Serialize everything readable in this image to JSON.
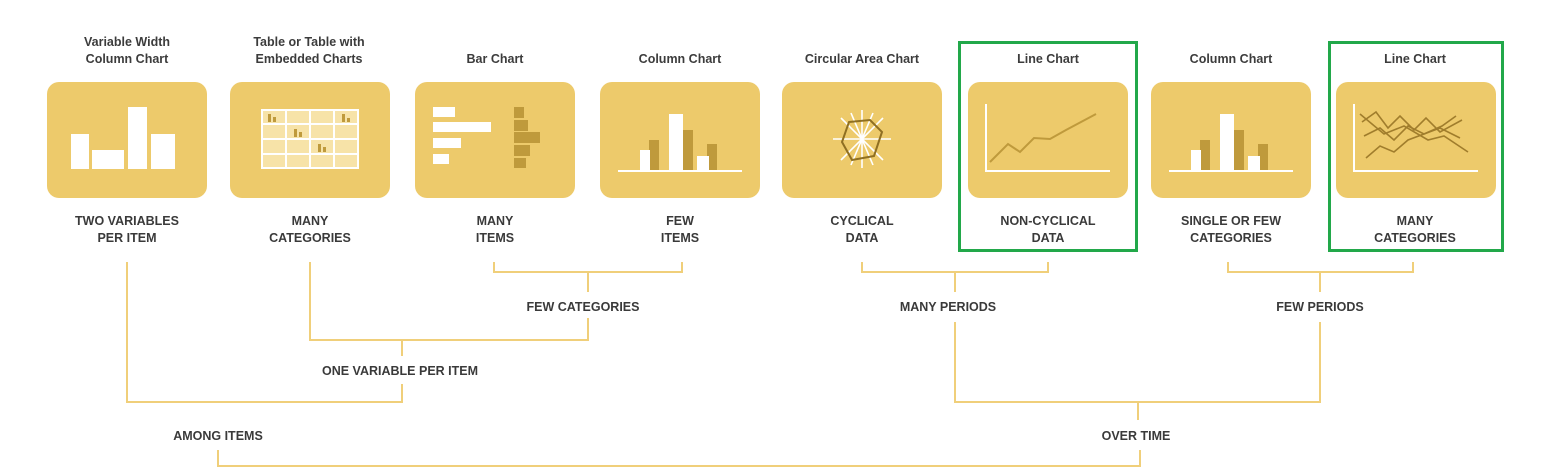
{
  "charts": [
    {
      "title": "Variable Width\nColumn Chart",
      "icon": "variable-width-column-chart-icon",
      "label": "TWO VARIABLES\nPER ITEM"
    },
    {
      "title": "Table or Table with\nEmbedded Charts",
      "icon": "table-with-embedded-charts-icon",
      "label": "MANY\nCATEGORIES"
    },
    {
      "title": "Bar Chart",
      "icon": "bar-chart-icon",
      "label": "MANY\nITEMS"
    },
    {
      "title": "Column Chart",
      "icon": "column-chart-icon",
      "label": "FEW\nITEMS"
    },
    {
      "title": "Circular Area Chart",
      "icon": "circular-area-chart-icon",
      "label": "CYCLICAL\nDATA"
    },
    {
      "title": "Line Chart",
      "icon": "line-chart-icon",
      "label": "NON-CYCLICAL\nDATA"
    },
    {
      "title": "Column Chart",
      "icon": "column-chart-icon",
      "label": "SINGLE OR FEW\nCATEGORIES"
    },
    {
      "title": "Line Chart",
      "icon": "multi-line-chart-icon",
      "label": "MANY\nCATEGORIES"
    }
  ],
  "groups": {
    "few_categories": "FEW CATEGORIES",
    "many_periods": "MANY PERIODS",
    "few_periods": "FEW PERIODS",
    "one_variable_per_item": "ONE VARIABLE PER ITEM",
    "among_items": "AMONG ITEMS",
    "over_time": "OVER TIME"
  },
  "colors": {
    "tile": "#edca6b",
    "icon": "#ffffff",
    "icon_dark": "#bf9a3c",
    "connector": "#f0cf7a",
    "highlight": "#22a84a"
  }
}
